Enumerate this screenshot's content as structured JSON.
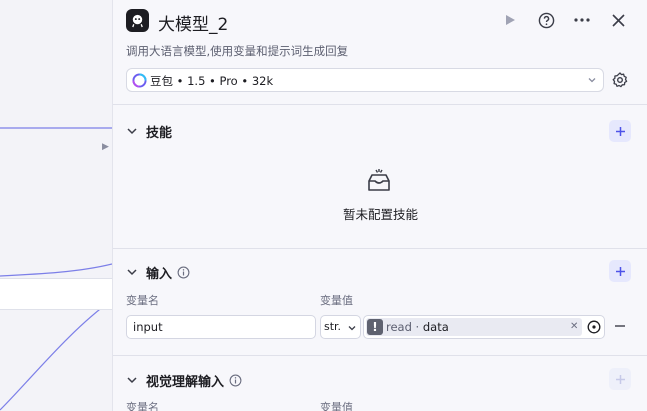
{
  "header": {
    "title": "大模型_2",
    "description": "调用大语言模型,使用变量和提示词生成回复",
    "logo_icon": "robot-icon",
    "run_icon": "play-icon",
    "help_icon": "help-circle-icon",
    "more_icon": "more-horizontal-icon",
    "close_icon": "close-icon"
  },
  "model": {
    "selected": "豆包 • 1.5 • Pro • 32k",
    "icon": "doubao-model-icon",
    "settings_icon": "gear-icon"
  },
  "skills": {
    "title": "技能",
    "empty_text": "暂未配置技能",
    "add_icon": "plus-icon"
  },
  "input": {
    "title": "输入",
    "col_name": "变量名",
    "col_value": "变量值",
    "rows": [
      {
        "name": "input",
        "type": "str.",
        "ref_node": "read",
        "ref_sep": " · ",
        "ref_field": "data"
      }
    ]
  },
  "vision_input": {
    "title": "视觉理解输入",
    "col_name": "变量名",
    "col_value": "变量值"
  },
  "colors": {
    "accent": "#4d53e8",
    "accent_bg": "#e6e8fd",
    "panel_bg": "#f7f7fb"
  }
}
